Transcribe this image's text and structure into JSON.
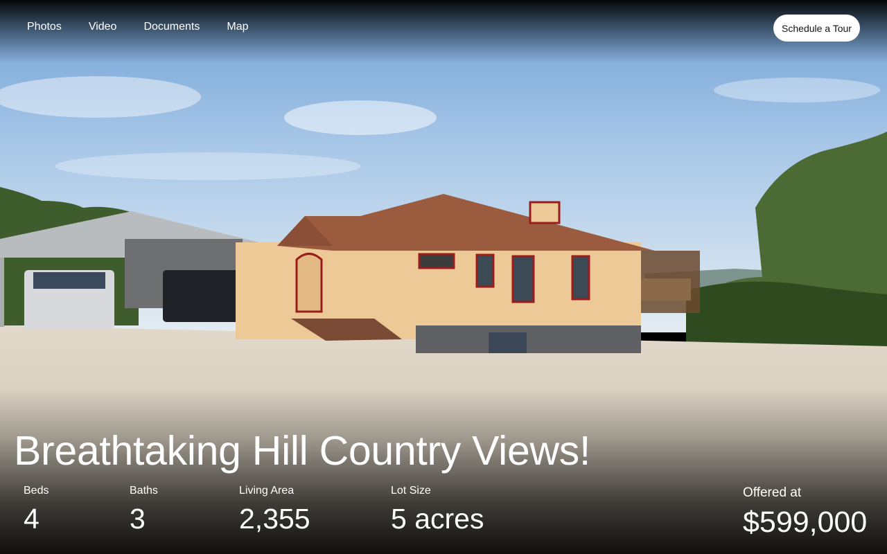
{
  "nav": {
    "items": [
      {
        "label": "Photos"
      },
      {
        "label": "Video"
      },
      {
        "label": "Documents"
      },
      {
        "label": "Map"
      }
    ]
  },
  "cta": {
    "label": "Schedule a Tour"
  },
  "listing": {
    "headline": "Breathtaking Hill Country Views!",
    "stats": [
      {
        "label": "Beds",
        "value": "4"
      },
      {
        "label": "Baths",
        "value": "3"
      },
      {
        "label": "Living Area",
        "value": "2,355"
      },
      {
        "label": "Lot Size",
        "value": "5 acres"
      }
    ],
    "price_label": "Offered at",
    "price": "$599,000"
  },
  "colors": {
    "sky": "#9fc3e6",
    "siding": "#ecc996",
    "roof": "#9a5b3e",
    "trim": "#9b1c1c",
    "gravel": "#d9d1c4",
    "cta_bg": "#ffffff"
  }
}
